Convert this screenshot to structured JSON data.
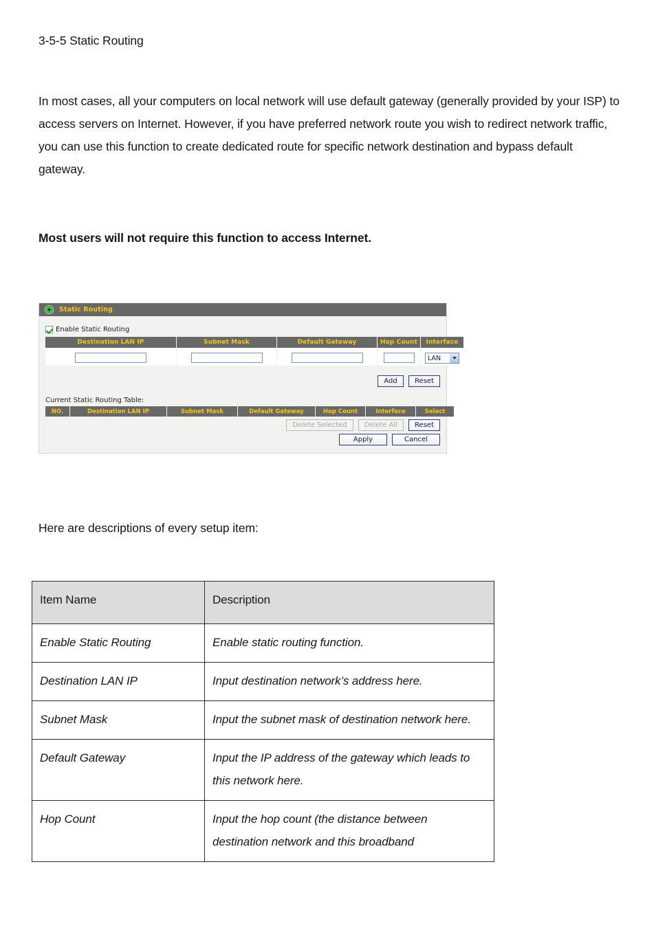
{
  "document": {
    "heading": "3-5-5 Static Routing",
    "paragraph_1": "In most cases, all your computers on local network will use default gateway (generally provided by your ISP) to access servers on Internet. However, if you have preferred network route you wish to redirect network traffic, you can use this function to create dedicated route for specific network destination and bypass default gateway.",
    "paragraph_bold": "Most users will not require this function to access Internet.",
    "paragraph_3": "Here are descriptions of every setup item:"
  },
  "router_panel": {
    "title": "Static Routing",
    "title_icon": "green-status-dot-icon",
    "enable_checkbox": {
      "label": "Enable Static Routing",
      "checked": true
    },
    "entry_table": {
      "headers": [
        "Destination LAN IP",
        "Subnet Mask",
        "Default Gateway",
        "Hop Count",
        "Interface"
      ],
      "row": {
        "destination_lan_ip": "",
        "subnet_mask": "",
        "default_gateway": "",
        "hop_count": "",
        "interface": "LAN"
      }
    },
    "entry_buttons": [
      {
        "label": "Add",
        "disabled": false
      },
      {
        "label": "Reset",
        "disabled": false
      }
    ],
    "current_table": {
      "caption": "Current Static Routing Table:",
      "headers": [
        "NO.",
        "Destination LAN IP",
        "Subnet Mask",
        "Default Gateway",
        "Hop Count",
        "Interface",
        "Select"
      ],
      "rows": []
    },
    "table_buttons": [
      {
        "label": "Delete Selected",
        "disabled": true
      },
      {
        "label": "Delete All",
        "disabled": true
      },
      {
        "label": "Reset",
        "disabled": false
      }
    ],
    "form_buttons": [
      {
        "label": "Apply",
        "disabled": false
      },
      {
        "label": "Cancel",
        "disabled": false
      }
    ],
    "colors": {
      "header_bar": "#686866",
      "header_text": "#f5c518",
      "panel_background": "#f2f2f0",
      "input_border": "#7f95ab",
      "button_border": "#2b3a80"
    }
  },
  "description_table": {
    "headers": [
      "Item Name",
      "Description"
    ],
    "rows": [
      {
        "item": "Enable Static Routing",
        "description": "Enable static routing function."
      },
      {
        "item": "Destination LAN IP",
        "description": "Input destination network’s address here."
      },
      {
        "item": "Subnet Mask",
        "description": "Input the subnet mask of destination network here."
      },
      {
        "item": "Default Gateway",
        "description": "Input the IP address of the gateway which leads to this network here."
      },
      {
        "item": "Hop Count",
        "description": "Input the hop count (the distance between destination network and this broadband"
      }
    ]
  }
}
